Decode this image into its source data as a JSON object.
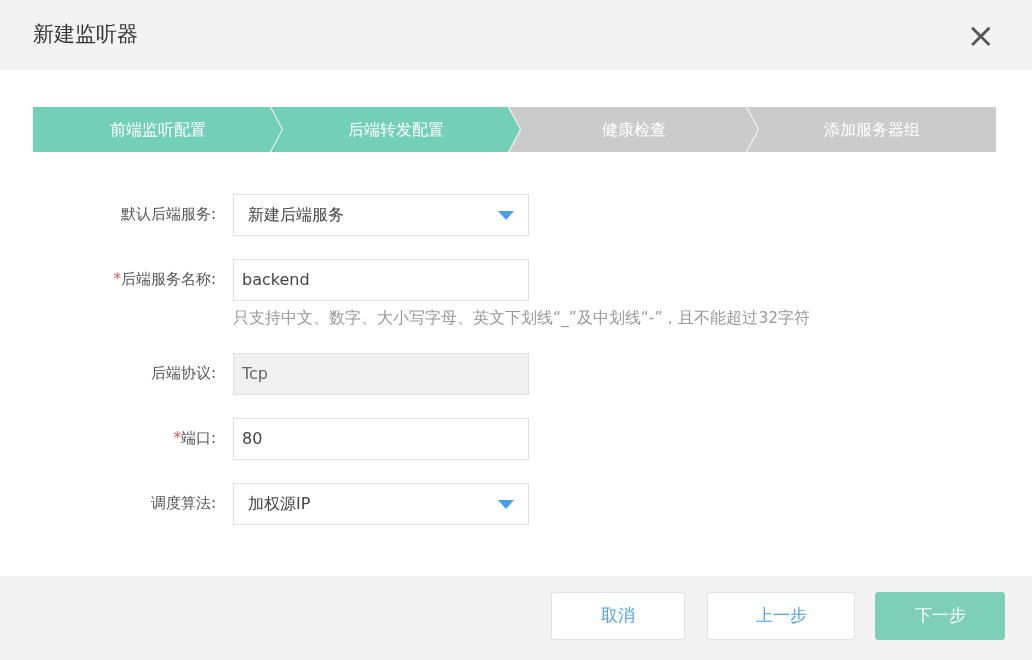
{
  "dialog": {
    "title": "新建监听器",
    "close": "×"
  },
  "steps": [
    {
      "label": "前端监听配置",
      "done": true
    },
    {
      "label": "后端转发配置",
      "done": true
    },
    {
      "label": "健康检查",
      "done": false
    },
    {
      "label": "添加服务器组",
      "done": false
    }
  ],
  "fields": [
    {
      "kind": "select",
      "label": "默认后端服务:",
      "value": "新建后端服务"
    },
    {
      "kind": "input",
      "required_mark": "*",
      "label": "后端服务名称:",
      "value": "backend",
      "hint": "只支持中文、数字、大小写字母、英文下划线“_”及中划线“-”，且不能超过32字符"
    },
    {
      "kind": "readonly",
      "label": "后端协议:",
      "value": "Tcp"
    },
    {
      "kind": "input",
      "required_mark": "*",
      "label": "端口:",
      "value": "80"
    },
    {
      "kind": "select",
      "label": "调度算法:",
      "value": "加权源IP"
    }
  ],
  "buttons": [
    {
      "label": "取消",
      "kind": "outline"
    },
    {
      "label": "上一步",
      "kind": "outline"
    },
    {
      "label": "下一步",
      "kind": "primary"
    }
  ]
}
